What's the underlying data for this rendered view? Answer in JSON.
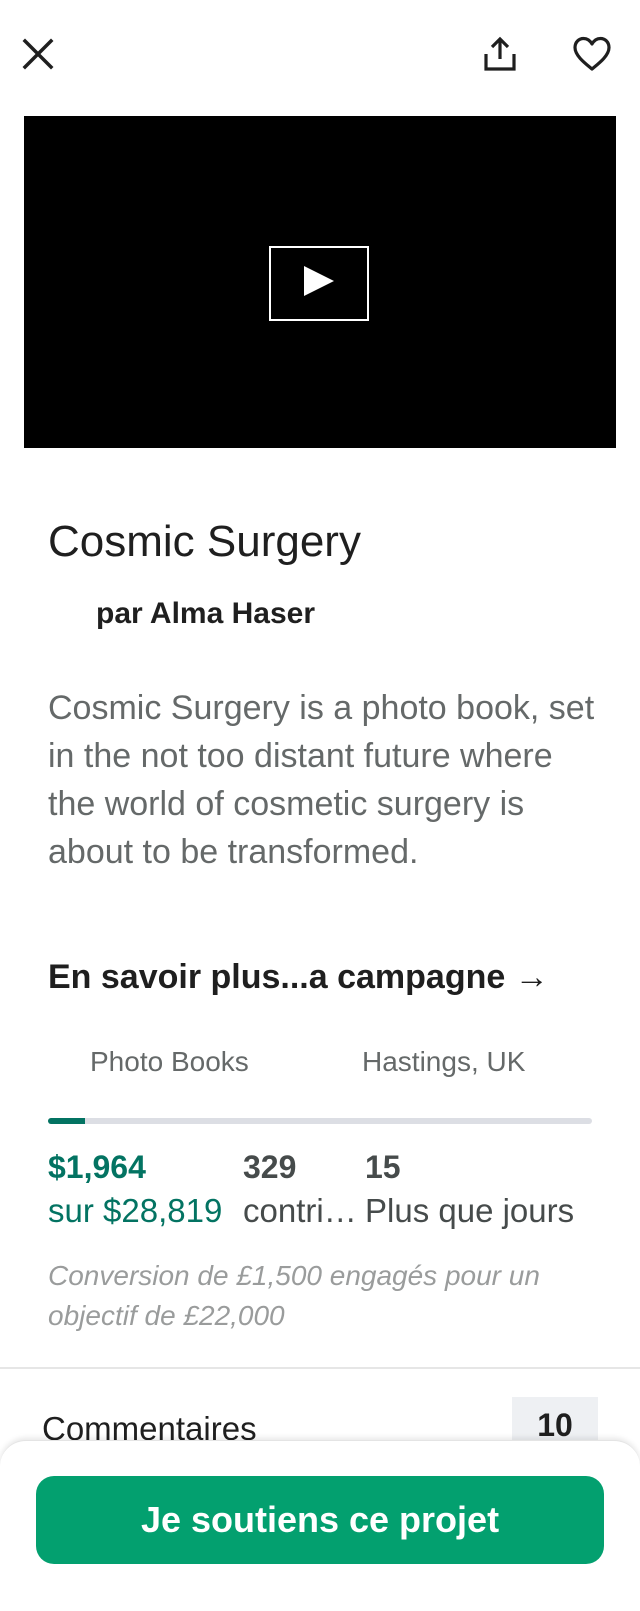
{
  "topbar": {
    "close_icon": "close-icon",
    "share_icon": "share-icon",
    "favorite_icon": "heart-icon"
  },
  "video": {
    "play_icon": "play-icon"
  },
  "project": {
    "title": "Cosmic Surgery",
    "creator": "par Alma Haser",
    "blurb": "Cosmic Surgery is a photo book, set in the not too distant future where the world of cosmetic surgery is about to be transformed.",
    "learn_more": "En savoir plus...a campagne →"
  },
  "tags": {
    "category": "Photo Books",
    "location": "Hastings, UK"
  },
  "funding": {
    "progress_fraction": 0.068,
    "pledged": "$1,964",
    "goal": "sur $28,819",
    "backers_count": "329",
    "backers_label": "contributeurs",
    "days_count": "15",
    "days_label": "Plus que jours",
    "conversion_note": "Conversion de £1,500 engagés pour un objectif de £22,000"
  },
  "comments": {
    "label": "Commentaires",
    "count": "10"
  },
  "cta": {
    "label": "Je soutiens ce projet"
  },
  "colors": {
    "accent_green": "#037362",
    "button_green": "#03a06f",
    "track_gray": "#dcdee4"
  }
}
